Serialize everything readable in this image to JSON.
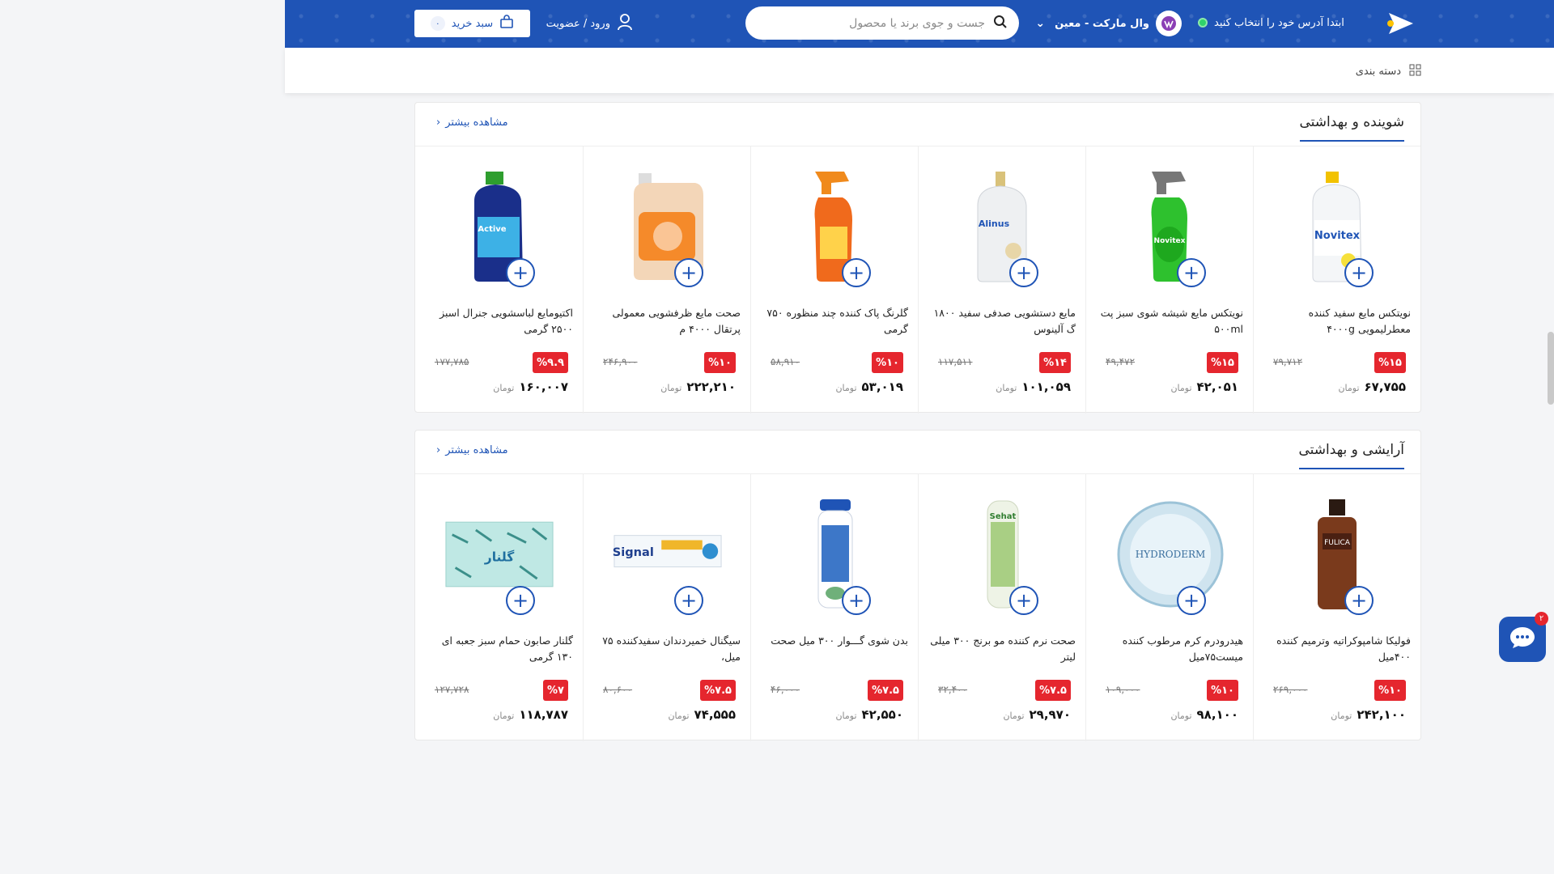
{
  "header": {
    "address_prompt": "ابتدا آدرس خود را انتخاب کنید",
    "store_name": "وال مارکت - معین",
    "search_placeholder": "جست و جوی برند یا محصول",
    "login_label": "ورود / عضویت",
    "cart_label": "سبد خرید",
    "cart_count": "۰",
    "categories_label": "دسته بندی"
  },
  "sections": [
    {
      "title": "شوینده و بهداشتی",
      "more_label": "مشاهده بیشتر",
      "products": [
        {
          "name": "نویتکس مایع سفید کننده معطرلیمویی ۴۰۰۰g",
          "discount": "%۱۵",
          "old_price": "۷۹,۷۱۲",
          "price": "۶۷,۷۵۵",
          "currency": "تومان",
          "icon": "bleach-bottle-icon"
        },
        {
          "name": "نویتکس مایع شیشه شوی سبز پت ۵۰۰ml",
          "discount": "%۱۵",
          "old_price": "۴۹,۴۷۲",
          "price": "۴۲,۰۵۱",
          "currency": "تومان",
          "icon": "spray-bottle-green-icon"
        },
        {
          "name": "مایع دستشویی صدفی سفید ۱۸۰۰ گ آلینوس",
          "discount": "%۱۴",
          "old_price": "۱۱۷,۵۱۱",
          "price": "۱۰۱,۰۵۹",
          "currency": "تومان",
          "icon": "handwash-bottle-icon"
        },
        {
          "name": "گلرنگ پاک کننده چند منظوره ۷۵۰ گرمی",
          "discount": "%۱۰",
          "old_price": "۵۸,۹۱۰",
          "price": "۵۳,۰۱۹",
          "currency": "تومان",
          "icon": "spray-bottle-orange-icon"
        },
        {
          "name": "صحت مایع ظرفشویی معمولی پرتقال ۴۰۰۰ م",
          "discount": "%۱۰",
          "old_price": "۲۴۶,۹۰۰",
          "price": "۲۲۲,۲۱۰",
          "currency": "تومان",
          "icon": "dish-soap-jug-icon"
        },
        {
          "name": "اکتیومایع لباسشویی جنرال اسبز ۲۵۰۰ گرمی",
          "discount": "%۹.۹",
          "old_price": "۱۷۷,۷۸۵",
          "price": "۱۶۰,۰۰۷",
          "currency": "تومان",
          "icon": "detergent-bottle-icon"
        }
      ]
    },
    {
      "title": "آرایشی و بهداشتی",
      "more_label": "مشاهده بیشتر",
      "products": [
        {
          "name": "فولیکا شامپوکراتیه وترمیم کننده ۴۰۰میل",
          "discount": "%۱۰",
          "old_price": "۲۶۹,۰۰۰",
          "price": "۲۴۲,۱۰۰",
          "currency": "تومان",
          "icon": "shampoo-bottle-icon"
        },
        {
          "name": "هیدرودرم کرم مرطوب کننده میست۷۵میل",
          "discount": "%۱۰",
          "old_price": "۱۰۹,۰۰۰",
          "price": "۹۸,۱۰۰",
          "currency": "تومان",
          "icon": "cream-jar-icon"
        },
        {
          "name": "صحت نرم کننده مو برنج ۳۰۰ میلی لیتر",
          "discount": "%۷.۵",
          "old_price": "۳۲,۴۰۰",
          "price": "۲۹,۹۷۰",
          "currency": "تومان",
          "icon": "conditioner-bottle-icon"
        },
        {
          "name": "بدن شوی گـــوار ۳۰۰ میل صحت",
          "discount": "%۷.۵",
          "old_price": "۴۶,۰۰۰",
          "price": "۴۲,۵۵۰",
          "currency": "تومان",
          "icon": "bodywash-bottle-icon"
        },
        {
          "name": "سیگنال خمیردندان سفیدکننده ۷۵ میل،",
          "discount": "%۷.۵",
          "old_price": "۸۰,۶۰۰",
          "price": "۷۴,۵۵۵",
          "currency": "تومان",
          "icon": "toothpaste-box-icon"
        },
        {
          "name": "گلنار صابون حمام سبز جعبه ای ۱۳۰ گرمی",
          "discount": "%۷",
          "old_price": "۱۲۷,۷۲۸",
          "price": "۱۱۸,۷۸۷",
          "currency": "تومان",
          "icon": "soap-box-icon"
        }
      ]
    }
  ],
  "chat": {
    "badge": "۲"
  },
  "colors": {
    "brand": "#1f54b6",
    "discount": "#e5262e",
    "online": "#2fd36b"
  }
}
